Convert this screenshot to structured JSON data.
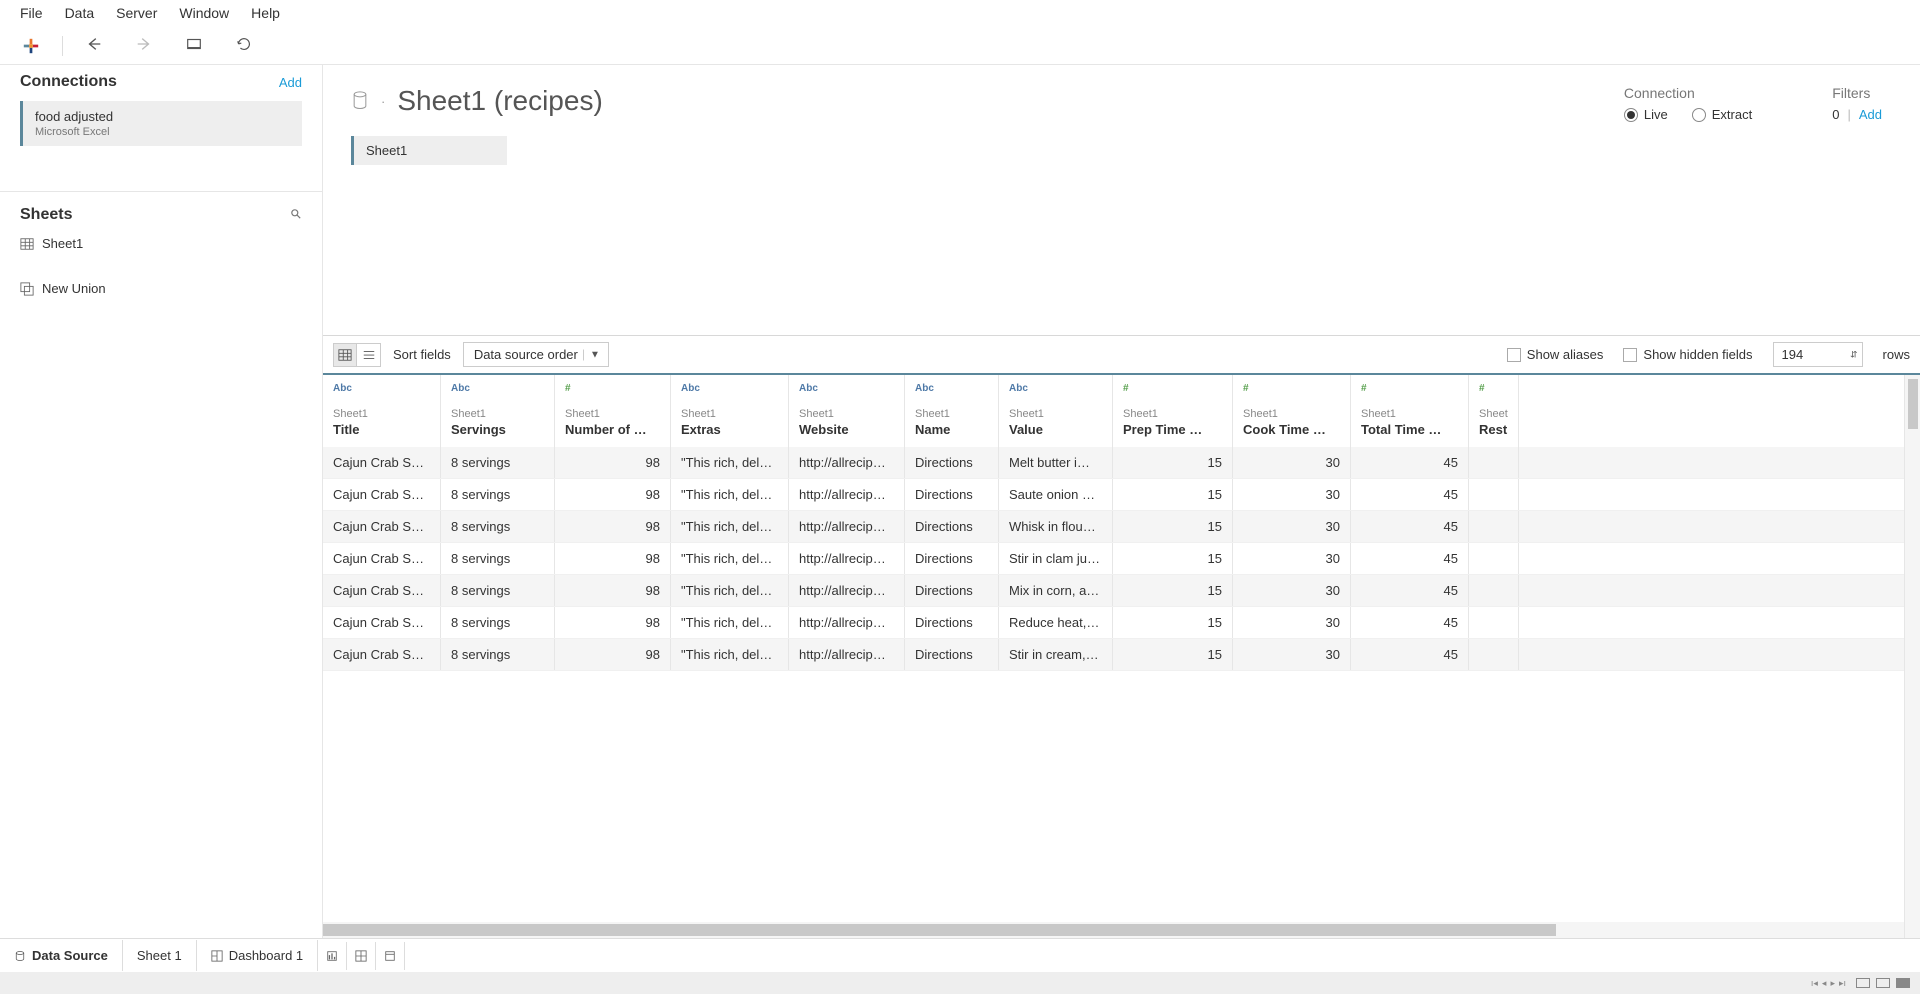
{
  "menu": {
    "items": [
      "File",
      "Data",
      "Server",
      "Window",
      "Help"
    ]
  },
  "left": {
    "connections_label": "Connections",
    "add_label": "Add",
    "connection": {
      "name": "food adjusted",
      "type": "Microsoft Excel"
    },
    "sheets_label": "Sheets",
    "sheet1": "Sheet1",
    "new_union": "New Union"
  },
  "canvas": {
    "title": "Sheet1 (recipes)",
    "table_pill": "Sheet1",
    "connection_label": "Connection",
    "live_label": "Live",
    "extract_label": "Extract",
    "filters_label": "Filters",
    "filters_count": "0",
    "filters_add": "Add"
  },
  "grid_controls": {
    "sort_label": "Sort fields",
    "sort_value": "Data source order",
    "show_aliases": "Show aliases",
    "show_hidden": "Show hidden fields",
    "rows_value": "194",
    "rows_label": "rows"
  },
  "columns": [
    {
      "type": "Abc",
      "src": "Sheet1",
      "name": "Title",
      "cls": "c-title",
      "num": false
    },
    {
      "type": "Abc",
      "src": "Sheet1",
      "name": "Servings",
      "cls": "c-serv",
      "num": false
    },
    {
      "type": "#",
      "src": "Sheet1",
      "name": "Number of …",
      "cls": "c-ning",
      "num": true
    },
    {
      "type": "Abc",
      "src": "Sheet1",
      "name": "Extras",
      "cls": "c-extra",
      "num": false
    },
    {
      "type": "Abc",
      "src": "Sheet1",
      "name": "Website",
      "cls": "c-web",
      "num": false
    },
    {
      "type": "Abc",
      "src": "Sheet1",
      "name": "Name",
      "cls": "c-name",
      "num": false
    },
    {
      "type": "Abc",
      "src": "Sheet1",
      "name": "Value",
      "cls": "c-value",
      "num": false
    },
    {
      "type": "#",
      "src": "Sheet1",
      "name": "Prep Time …",
      "cls": "c-prep",
      "num": true
    },
    {
      "type": "#",
      "src": "Sheet1",
      "name": "Cook Time …",
      "cls": "c-cook",
      "num": true
    },
    {
      "type": "#",
      "src": "Sheet1",
      "name": "Total Time …",
      "cls": "c-total",
      "num": true
    },
    {
      "type": "#",
      "src": "Sheet",
      "name": "Rest",
      "cls": "c-rest",
      "num": true
    }
  ],
  "rows": [
    [
      "Cajun Crab So…",
      "8 servings",
      "98",
      "\"This rich, del…",
      "http://allrecip…",
      "Directions",
      "Melt butter i…",
      "15",
      "30",
      "45",
      ""
    ],
    [
      "Cajun Crab So…",
      "8 servings",
      "98",
      "\"This rich, del…",
      "http://allrecip…",
      "Directions",
      "Saute onion a…",
      "15",
      "30",
      "45",
      ""
    ],
    [
      "Cajun Crab So…",
      "8 servings",
      "98",
      "\"This rich, del…",
      "http://allrecip…",
      "Directions",
      "Whisk in flou…",
      "15",
      "30",
      "45",
      ""
    ],
    [
      "Cajun Crab So…",
      "8 servings",
      "98",
      "\"This rich, del…",
      "http://allrecip…",
      "Directions",
      "Stir in clam ju…",
      "15",
      "30",
      "45",
      ""
    ],
    [
      "Cajun Crab So…",
      "8 servings",
      "98",
      "\"This rich, del…",
      "http://allrecip…",
      "Directions",
      "Mix in corn, a…",
      "15",
      "30",
      "45",
      ""
    ],
    [
      "Cajun Crab So…",
      "8 servings",
      "98",
      "\"This rich, del…",
      "http://allrecip…",
      "Directions",
      "Reduce heat, …",
      "15",
      "30",
      "45",
      ""
    ],
    [
      "Cajun Crab So…",
      "8 servings",
      "98",
      "\"This rich, del…",
      "http://allrecip…",
      "Directions",
      "Stir in cream,…",
      "15",
      "30",
      "45",
      ""
    ]
  ],
  "bottom": {
    "data_source": "Data Source",
    "sheet1": "Sheet 1",
    "dashboard1": "Dashboard 1"
  }
}
